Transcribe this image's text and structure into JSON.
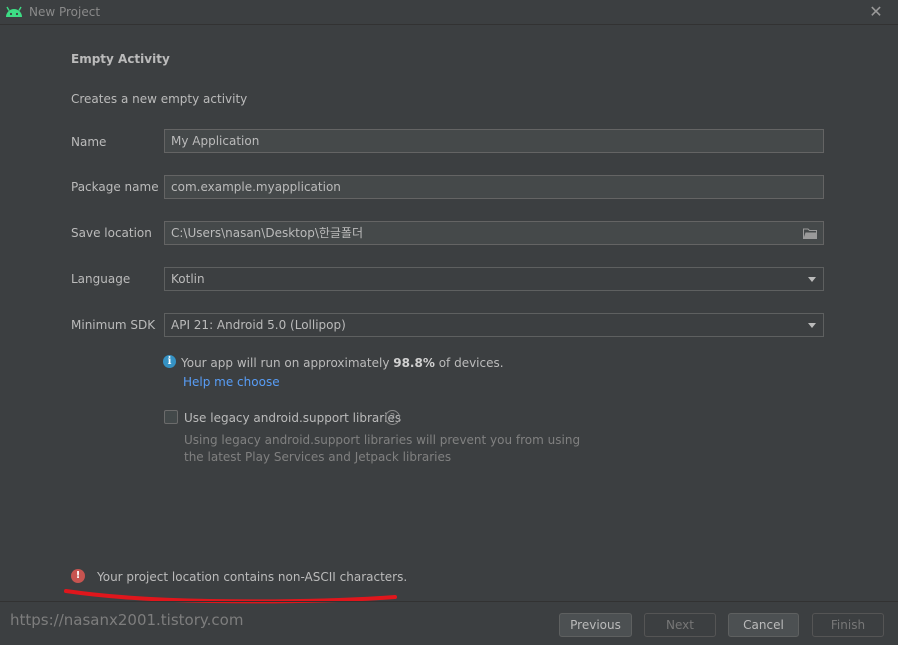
{
  "window": {
    "title": "New Project",
    "app_icon": "android-icon",
    "close_icon": "close-icon"
  },
  "form": {
    "heading": "Empty Activity",
    "description": "Creates a new empty activity",
    "name_label": "Name",
    "name_value": "My Application",
    "package_label": "Package name",
    "package_value": "com.example.myapplication",
    "save_label": "Save location",
    "save_value": "C:\\Users\\nasan\\Desktop\\한글폴더",
    "language_label": "Language",
    "language_value": "Kotlin",
    "sdk_label": "Minimum SDK",
    "sdk_value": "API 21: Android 5.0 (Lollipop)"
  },
  "info": {
    "prefix": "Your app will run on approximately ",
    "percent": "98.8%",
    "suffix": " of devices.",
    "help_link": "Help me choose"
  },
  "legacy": {
    "checked": false,
    "label": "Use legacy android.support libraries",
    "hint_line1": "Using legacy android.support libraries will prevent you from using",
    "hint_line2": "the latest Play Services and Jetpack libraries"
  },
  "error": {
    "message": "Your project location contains non-ASCII characters."
  },
  "watermark": "https://nasanx2001.tistory.com",
  "buttons": {
    "previous": "Previous",
    "next": "Next",
    "cancel": "Cancel",
    "finish": "Finish"
  },
  "colors": {
    "background": "#3c3f41",
    "field_background": "#45494a",
    "link": "#589df6",
    "info_icon": "#3592c4",
    "error_icon": "#c75450",
    "annotation": "#e0161c",
    "android_green": "#3ddc84"
  }
}
